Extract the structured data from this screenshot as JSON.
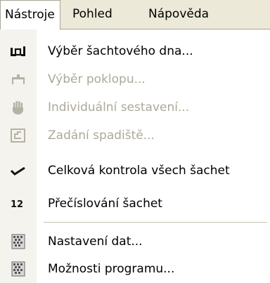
{
  "menubar": {
    "items": [
      {
        "label": "Nástroje"
      },
      {
        "label": "Pohled"
      },
      {
        "label": "Nápověda"
      }
    ]
  },
  "menu": {
    "items": [
      {
        "label": "Výběr šachtového dna...",
        "icon": "shaft-bottom-icon",
        "enabled": true
      },
      {
        "label": "Výběr poklopu...",
        "icon": "manhole-cover-icon",
        "enabled": false
      },
      {
        "label": "Individuální sestavení...",
        "icon": "hand-icon",
        "enabled": false
      },
      {
        "label": "Zadání spadiště...",
        "icon": "drop-shaft-icon",
        "enabled": false
      },
      {
        "label": "Celková kontrola všech šachet",
        "icon": "checkmark-icon",
        "enabled": true
      },
      {
        "label": "Přečíslování šachet",
        "icon": "renumber-icon",
        "icon_text": "12",
        "enabled": true
      },
      {
        "label": "Nastavení dat...",
        "icon": "data-settings-icon",
        "enabled": true
      },
      {
        "label": "Možnosti programu...",
        "icon": "program-options-icon",
        "enabled": true
      }
    ]
  },
  "colors": {
    "menubar_bg": "#ece9d8",
    "icon_strip_bg": "#f4f3ee",
    "disabled_text": "#aca899",
    "text": "#000000"
  }
}
